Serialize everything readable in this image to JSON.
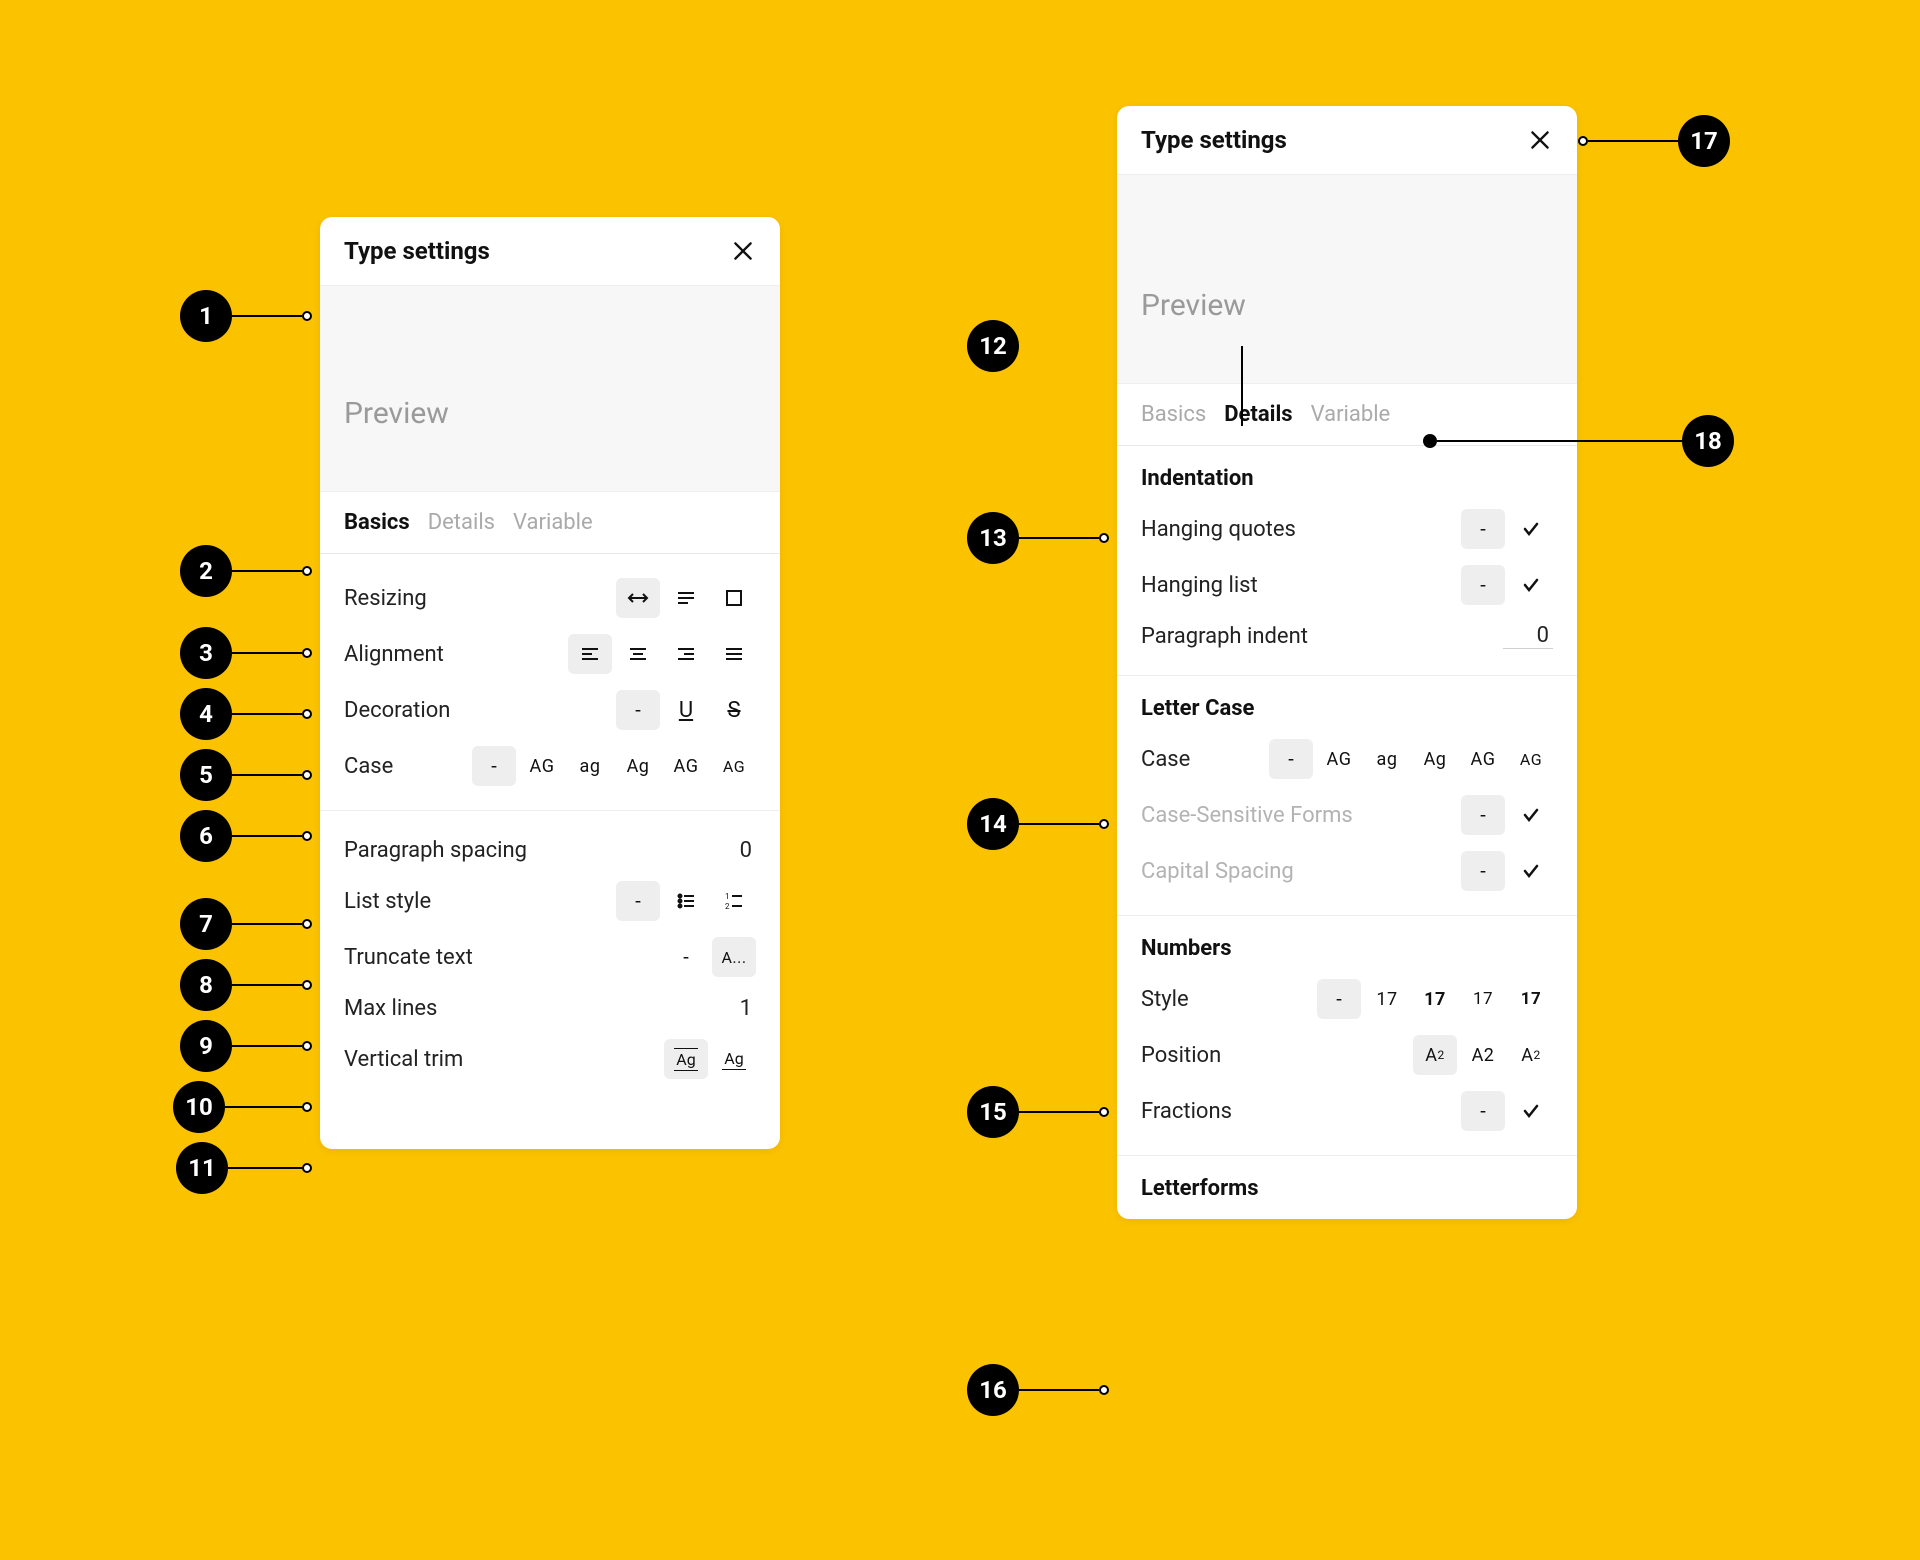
{
  "left_panel": {
    "title": "Type settings",
    "preview_placeholder": "Preview",
    "tabs": [
      "Basics",
      "Details",
      "Variable"
    ],
    "active_tab": "Basics",
    "rows": {
      "resizing": "Resizing",
      "alignment": "Alignment",
      "decoration": "Decoration",
      "case": "Case",
      "paragraph_spacing": "Paragraph spacing",
      "paragraph_spacing_value": "0",
      "list_style": "List style",
      "truncate": "Truncate text",
      "max_lines": "Max lines",
      "max_lines_value": "1",
      "vertical_trim": "Vertical trim"
    },
    "case_glyphs": [
      "-",
      "AG",
      "ag",
      "Ag",
      "AG",
      "AG"
    ],
    "truncate_glyphs": [
      "-",
      "A..."
    ]
  },
  "right_panel": {
    "title": "Type settings",
    "preview_placeholder": "Preview",
    "tabs": [
      "Basics",
      "Details",
      "Variable"
    ],
    "active_tab": "Details",
    "indentation": {
      "header": "Indentation",
      "hanging_quotes": "Hanging quotes",
      "hanging_list": "Hanging list",
      "paragraph_indent": "Paragraph indent",
      "paragraph_indent_value": "0"
    },
    "letter_case": {
      "header": "Letter Case",
      "case": "Case",
      "case_glyphs": [
        "-",
        "AG",
        "ag",
        "Ag",
        "AG",
        "AG"
      ],
      "csf": "Case-Sensitive Forms",
      "capital_spacing": "Capital Spacing"
    },
    "numbers": {
      "header": "Numbers",
      "style": "Style",
      "style_glyphs": [
        "-",
        "17",
        "17",
        "17",
        "17"
      ],
      "position": "Position",
      "fractions": "Fractions"
    },
    "letterforms_header": "Letterforms"
  },
  "annotations": {
    "a1": "1",
    "a2": "2",
    "a3": "3",
    "a4": "4",
    "a5": "5",
    "a6": "6",
    "a7": "7",
    "a8": "8",
    "a9": "9",
    "a10": "10",
    "a11": "11",
    "a12": "12",
    "a13": "13",
    "a14": "14",
    "a15": "15",
    "a16": "16",
    "a17": "17",
    "a18": "18"
  }
}
